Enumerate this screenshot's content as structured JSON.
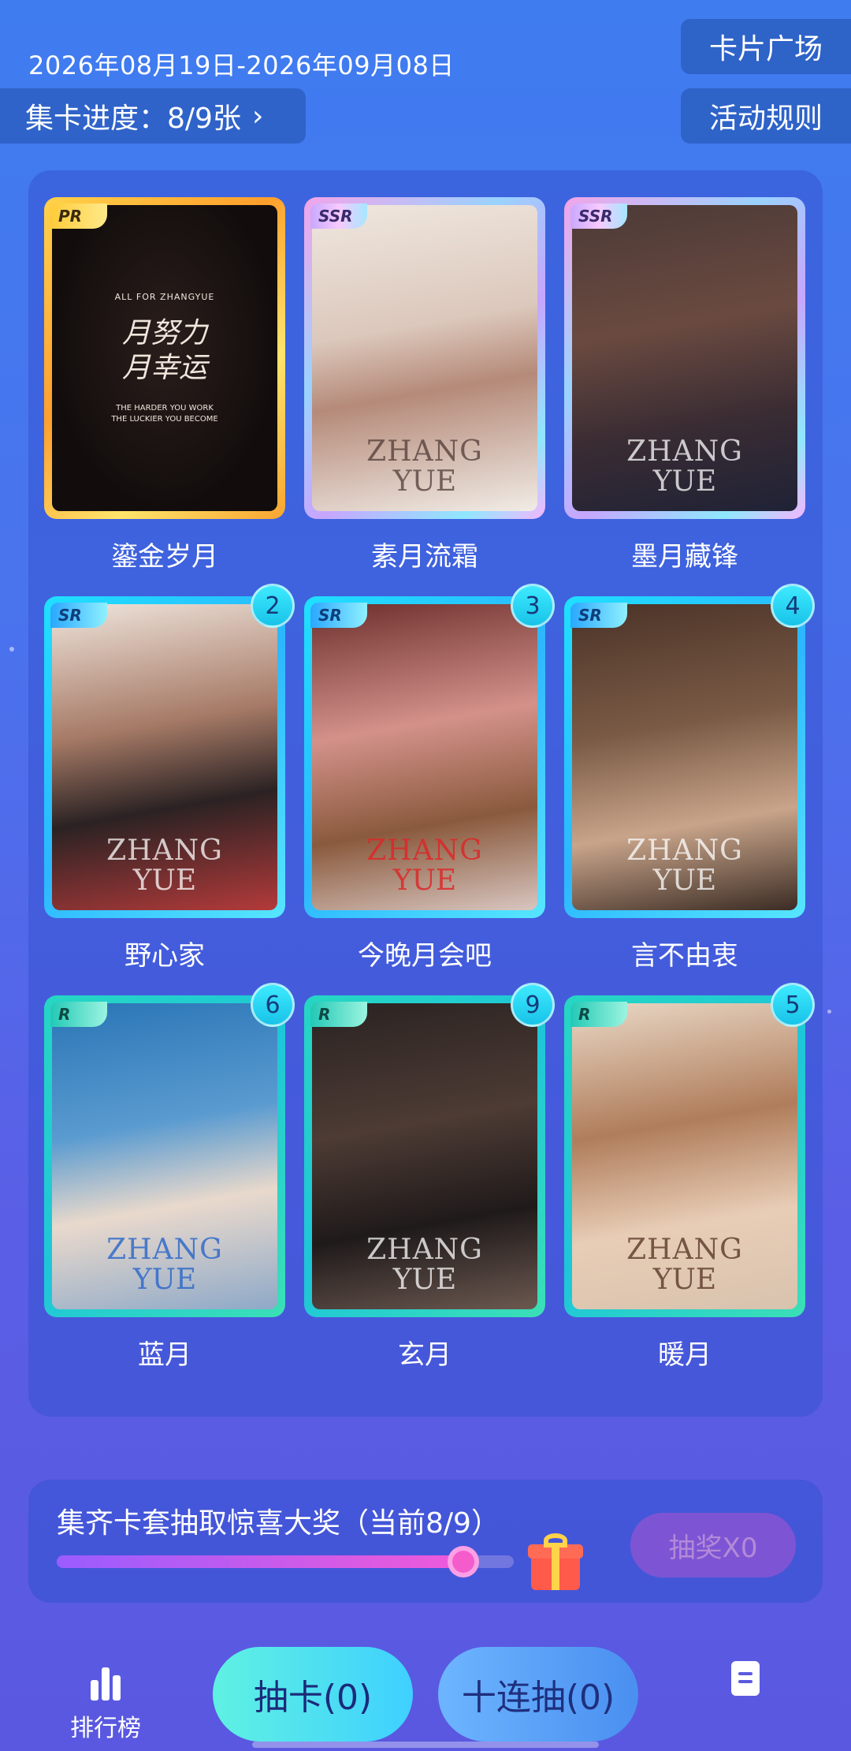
{
  "header": {
    "date_range": "2026年08月19日-2026年09月08日",
    "progress_label": "集卡进度：8/9张",
    "chevron": "›",
    "card_plaza": "卡片广场",
    "event_rules": "活动规则"
  },
  "cards": [
    {
      "name": "鎏金岁月",
      "rarity": "PR",
      "count": null
    },
    {
      "name": "素月流霜",
      "rarity": "SSR",
      "count": null
    },
    {
      "name": "墨月藏锋",
      "rarity": "SSR",
      "count": null
    },
    {
      "name": "野心家",
      "rarity": "SR",
      "count": "2"
    },
    {
      "name": "今晚月会吧",
      "rarity": "SR",
      "count": "3"
    },
    {
      "name": "言不由衷",
      "rarity": "SR",
      "count": "4"
    },
    {
      "name": "蓝月",
      "rarity": "R",
      "count": "6"
    },
    {
      "name": "玄月",
      "rarity": "R",
      "count": "9"
    },
    {
      "name": "暖月",
      "rarity": "R",
      "count": "5"
    }
  ],
  "card_art": {
    "zhang": "ZHANG",
    "yue": "YUE",
    "pr_top": "ALL FOR ZHANGYUE",
    "pr_line1": "月努力",
    "pr_line2": "月幸运",
    "pr_bottom1": "THE HARDER YOU WORK",
    "pr_bottom2": "THE LUCKIER YOU BECOME"
  },
  "lottery": {
    "title": "集齐卡套抽取惊喜大奖（当前8/9）",
    "progress": 0.889,
    "button_label": "抽奖X0"
  },
  "bottom_nav": {
    "rank_label": "排行榜",
    "draw_single": "抽卡(0)",
    "draw_ten": "十连抽(0)"
  },
  "icons": {
    "rank": "ranking-bars-icon",
    "doc": "document-icon",
    "gift": "gift-box-icon"
  }
}
